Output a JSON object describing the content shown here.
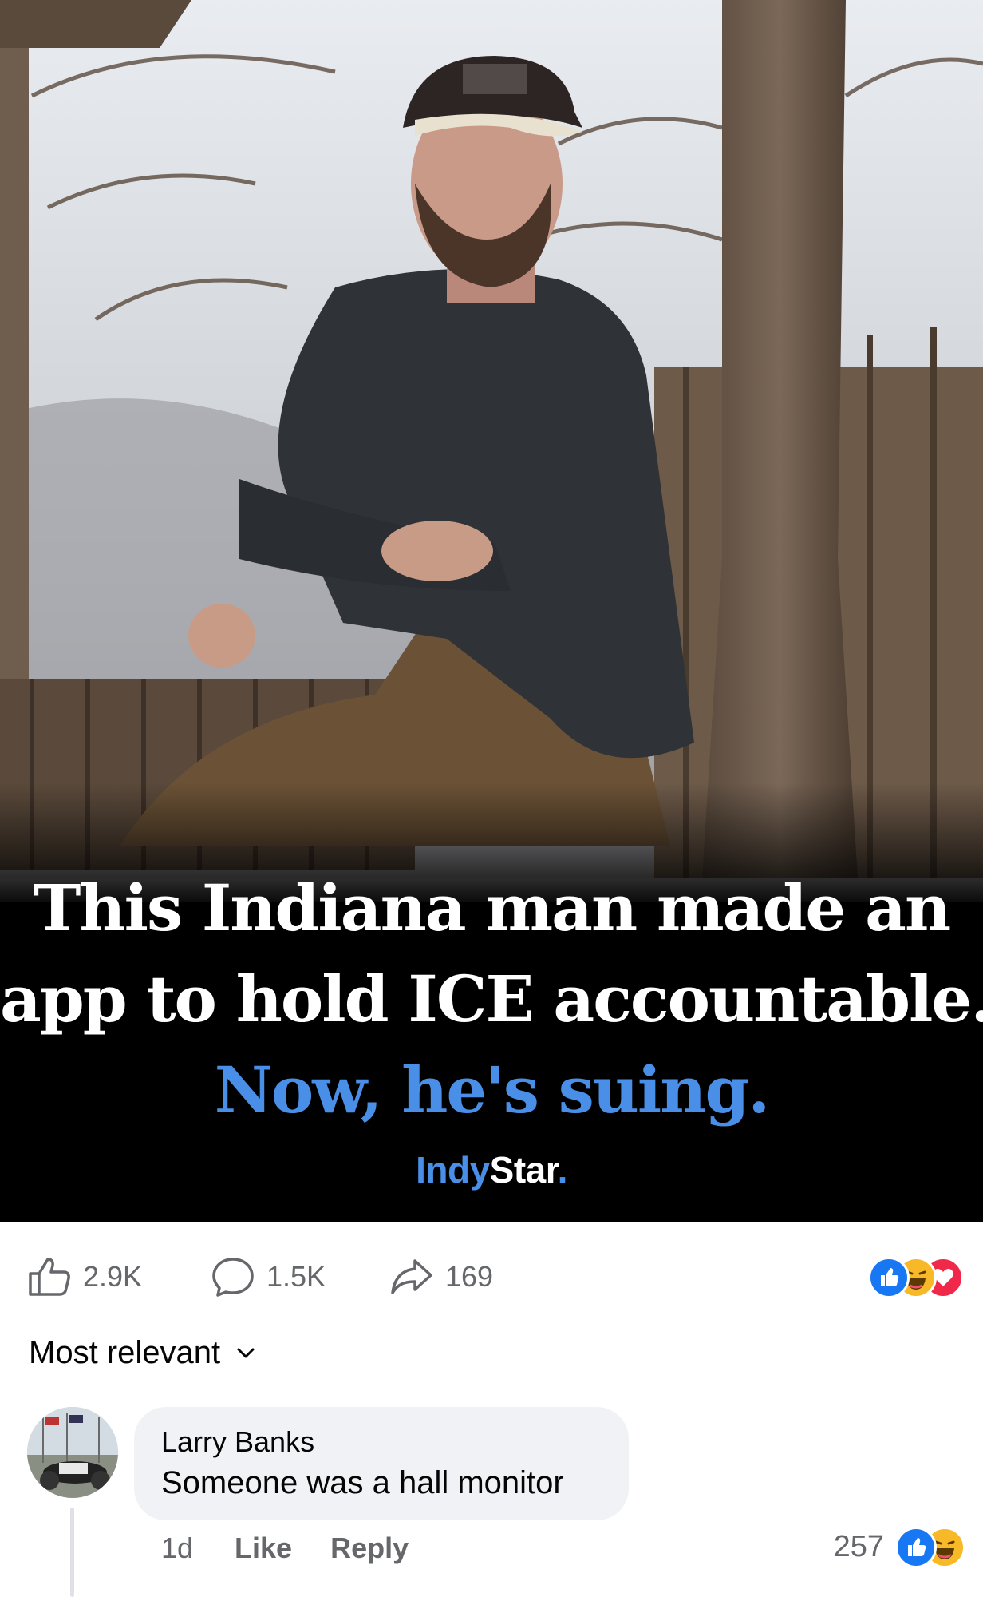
{
  "post": {
    "headline_line1": "This Indiana man made an",
    "headline_line2": "app to hold ICE accountable.",
    "headline_line3": "Now, he's suing.",
    "brand_part1": "Indy",
    "brand_part2": "Star",
    "brand_dot": "."
  },
  "actions": {
    "likes": "2.9K",
    "comments": "1.5K",
    "shares": "169",
    "reaction_icons": [
      "like-icon",
      "haha-icon",
      "love-icon"
    ]
  },
  "sort": {
    "label": "Most relevant"
  },
  "comment": {
    "author": "Larry Banks",
    "text": "Someone was a hall monitor",
    "time": "1d",
    "like_label": "Like",
    "reply_label": "Reply",
    "reaction_count": "257",
    "reaction_icons": [
      "like-icon",
      "haha-icon"
    ]
  },
  "colors": {
    "headline_accent": "#4a8fe7",
    "like_blue": "#1877f2",
    "love_red": "#f02849",
    "haha_yellow": "#f7b928",
    "meta_gray": "#65676b",
    "bubble_bg": "#f0f2f5"
  }
}
